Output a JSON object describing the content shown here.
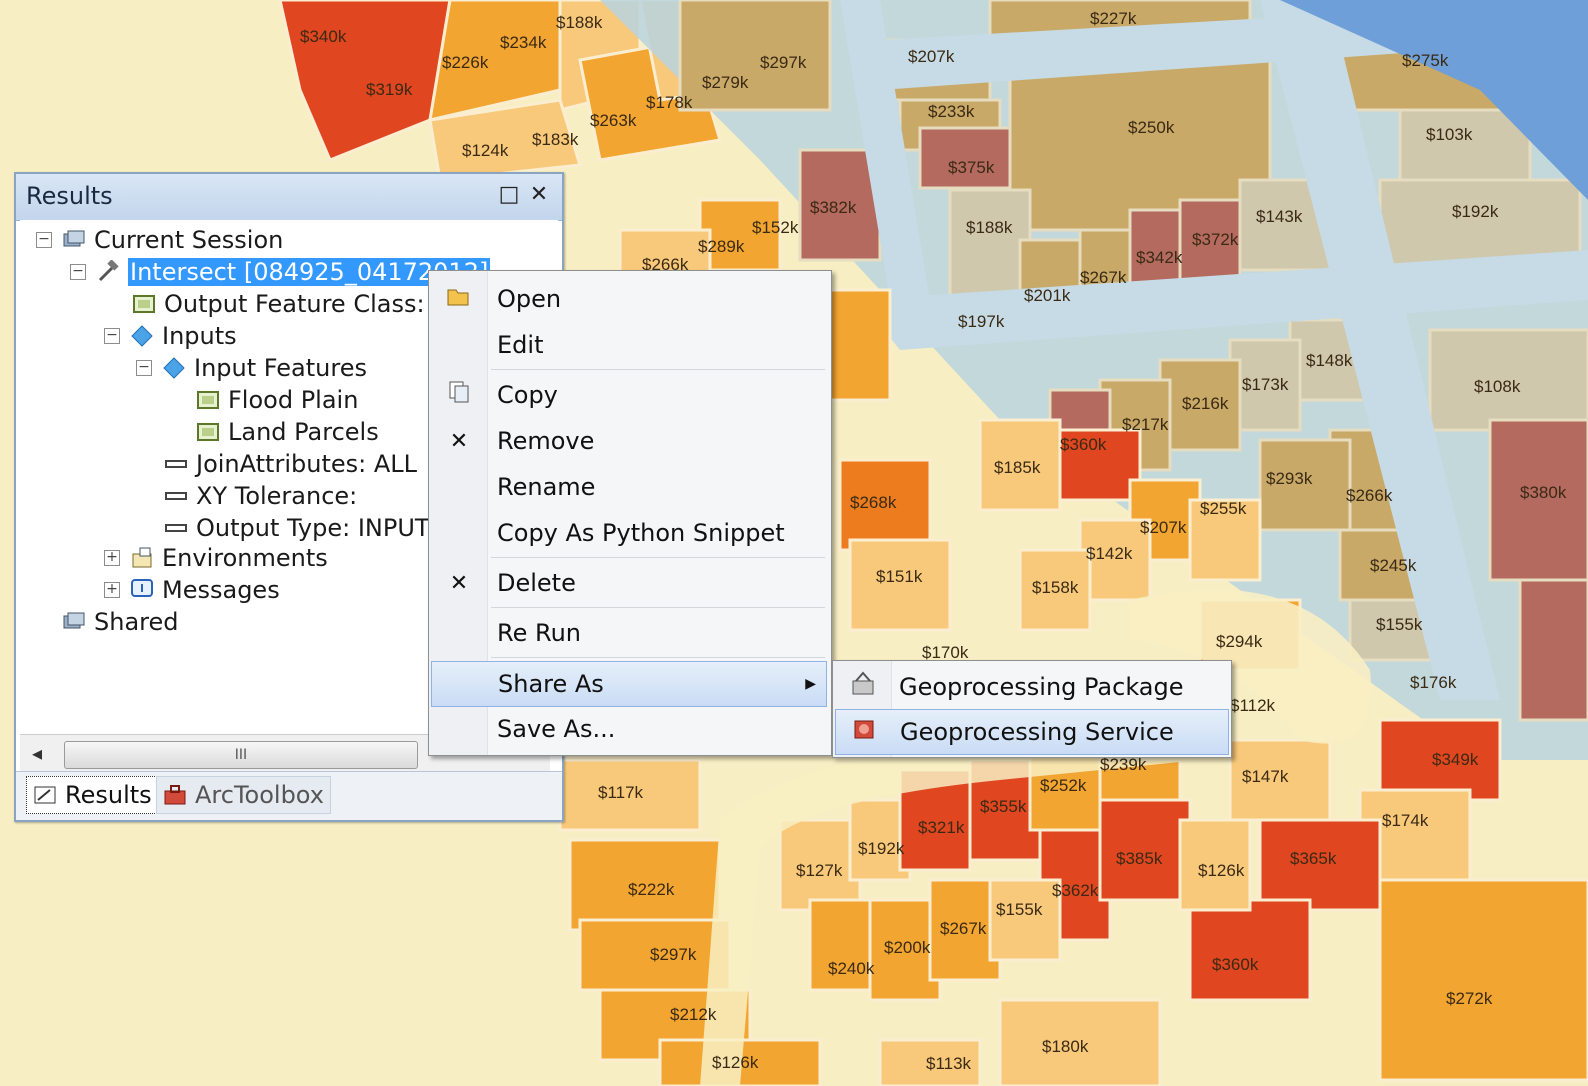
{
  "map": {
    "labels": [
      "$340k",
      "$319k",
      "$226k",
      "$234k",
      "$188k",
      "$124k",
      "$183k",
      "$263k",
      "$178k",
      "$279k",
      "$297k",
      "$227k",
      "$207k",
      "$233k",
      "$250k",
      "$275k",
      "$103k",
      "$375k",
      "$382k",
      "$152k",
      "$289k",
      "$266k",
      "$188k",
      "$143k",
      "$192k",
      "$372k",
      "$342k",
      "$267k",
      "$201k",
      "$197k",
      "$148k",
      "$173k",
      "$108k",
      "$216k",
      "$217k",
      "$360k",
      "$185k",
      "$268k",
      "$293k",
      "$266k",
      "$380k",
      "$255k",
      "$207k",
      "$142k",
      "$245k",
      "$151k",
      "$158k",
      "$155k",
      "$294k",
      "$170k",
      "$176k",
      "$112k",
      "$349k",
      "$239k",
      "$147k",
      "$117k",
      "$252k",
      "$355k",
      "$321k",
      "$174k",
      "$192k",
      "$385k",
      "$126k",
      "$365k",
      "$127k",
      "$362k",
      "$222k",
      "$155k",
      "$267k",
      "$200k",
      "$240k",
      "$297k",
      "$360k",
      "$272k",
      "$212k",
      "$126k",
      "$180k",
      "$113k"
    ],
    "colors": {
      "very_low": "#f8eec3",
      "low": "#f8c97a",
      "mid": "#f3a531",
      "high": "#ec7c1e",
      "very_high": "#e0461f",
      "zone_tan": "#c9a967",
      "zone_gray": "#cfc8ad",
      "zone_mauve": "#b46a5e",
      "flood_blue": "#b9d3df",
      "water": "#6f9fd8"
    }
  },
  "results": {
    "title": "Results",
    "restore_glyph": "□",
    "close_glyph": "✕",
    "tree": {
      "current_session": "Current Session",
      "intersect": "Intersect [084925_04172012]",
      "output_feature_class": "Output Feature Class: P",
      "inputs": "Inputs",
      "input_features": "Input Features",
      "flood_plain": "Flood Plain",
      "land_parcels": "Land Parcels",
      "join_attributes": "JoinAttributes: ALL",
      "xy_tolerance": "XY Tolerance:",
      "output_type": "Output Type: INPUT",
      "environments": "Environments",
      "messages": "Messages",
      "shared": "Shared"
    },
    "scroll_thumb_glyph": "III",
    "tabs": [
      "Results",
      "ArcToolbox"
    ]
  },
  "context_menu": {
    "items": [
      "Open",
      "Edit",
      "Copy",
      "Remove",
      "Rename",
      "Copy As Python Snippet",
      "Delete",
      "Re Run",
      "Share As",
      "Save As..."
    ],
    "highlighted": "Share As"
  },
  "submenu": {
    "items": [
      "Geoprocessing Package",
      "Geoprocessing Service"
    ],
    "highlighted": "Geoprocessing Service"
  }
}
